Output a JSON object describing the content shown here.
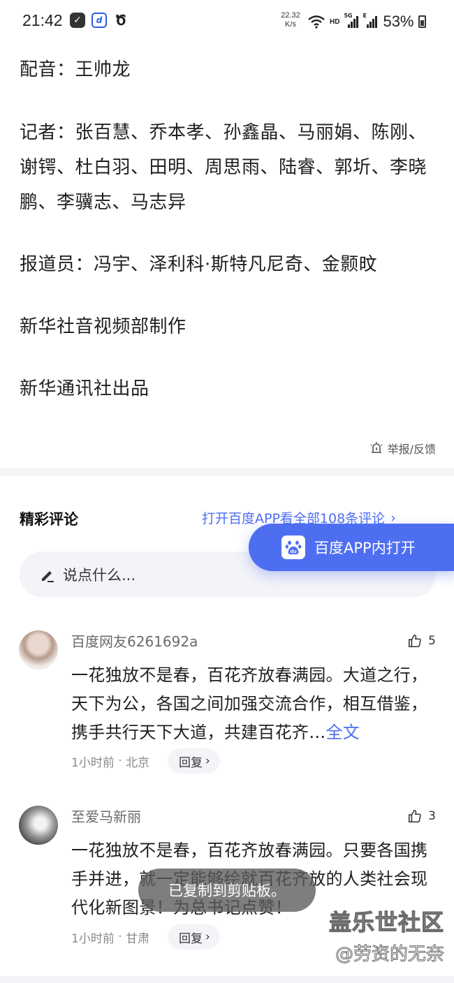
{
  "status_bar": {
    "time": "21:42",
    "speed_value": "22.32",
    "speed_unit": "K/s",
    "network_hd": "HD",
    "signal1_tag": "5G",
    "signal2_tag": "E",
    "battery_percent": "53%",
    "icons": [
      "check-app-icon",
      "baidu-netdisk-icon",
      "alarm-icon",
      "wifi-icon",
      "signal-icon",
      "battery-icon"
    ]
  },
  "article": {
    "dubbing": "配音：王帅龙",
    "reporters": "记者：张百慧、乔本孝、孙鑫晶、马丽娟、陈刚、谢锷、杜白羽、田明、周思雨、陆睿、郭圻、李晓鹏、李骥志、马志异",
    "correspondents": "报道员：冯宇、泽利科·斯特凡尼奇、金颢旼",
    "production": "新华社音视频部制作",
    "publisher": "新华通讯社出品",
    "report_label": "举报/反馈"
  },
  "comments": {
    "title": "精彩评论",
    "open_all_label": "打开百度APP看全部108条评论",
    "float_button_label": "百度APP内打开",
    "input_placeholder": "说点什么...",
    "items": [
      {
        "user": "百度网友6261692a",
        "likes": "5",
        "body": "一花独放不是春，百花齐放春满园。大道之行，天下为公，各国之间加强交流合作，相互借鉴，携手共行天下大道，共建百花齐…",
        "more": "全文",
        "time": "1小时前",
        "location": "北京",
        "reply_label": "回复"
      },
      {
        "user": "至爱马新丽",
        "likes": "3",
        "body": "一花独放不是春，百花齐放春满园。只要各国携手并进，就一定能够绘就百花齐放的人类社会现代化新图景！为总书记点赞！",
        "time": "1小时前",
        "location": "甘肃",
        "reply_label": "回复"
      }
    ]
  },
  "toast": "已复制到剪贴板。",
  "watermark": {
    "title": "盖乐世社区",
    "author": "@劳资的无奈"
  },
  "colors": {
    "accent": "#4e6ef2",
    "text": "#1f1f1f",
    "muted": "#888888",
    "divider": "#f3f4f7"
  }
}
